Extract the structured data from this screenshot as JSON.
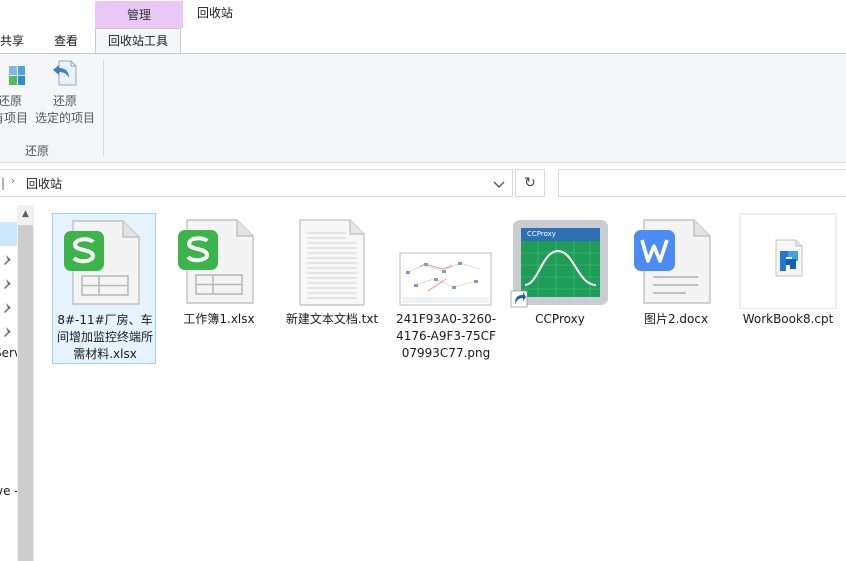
{
  "window": {
    "title": "回收站"
  },
  "ribbon": {
    "contextual_header": "管理",
    "tabs": {
      "share": "共享",
      "view": "查看",
      "active": "回收站工具"
    },
    "buttons": {
      "restore_all_line1": "还原",
      "restore_all_line2": "有项目",
      "restore_sel_line1": "还原",
      "restore_sel_line2": "选定的项目"
    },
    "group_label": "还原"
  },
  "address": {
    "prefix": "|",
    "location": "回收站"
  },
  "nav": {
    "partial_item_1": "Serv",
    "partial_item_2": "ve -"
  },
  "files": [
    {
      "name": "8#-11#厂房、车间增加监控终端所需材料.xlsx",
      "icon": "wps-spreadsheet-icon",
      "selected": true
    },
    {
      "name": "工作簿1.xlsx",
      "icon": "wps-spreadsheet-icon"
    },
    {
      "name": "新建文本文档.txt",
      "icon": "text-file-icon"
    },
    {
      "name": "241F93A0-3260-4176-A9F3-75CF07993C77.png",
      "icon": "image-thumbnail"
    },
    {
      "name": "CCProxy",
      "icon": "ccproxy-shortcut-icon",
      "thumb_text": "CCProxy"
    },
    {
      "name": "图片2.docx",
      "icon": "wps-writer-icon"
    },
    {
      "name": "WorkBook8.cpt",
      "icon": "cpt-file-icon"
    }
  ],
  "colors": {
    "contextual_tab": "#eac8f6",
    "wps_green": "#3bb44a",
    "wps_blue": "#4b8bf4",
    "selection": "#e5f3ff",
    "ccproxy_green": "#1f9c58"
  }
}
